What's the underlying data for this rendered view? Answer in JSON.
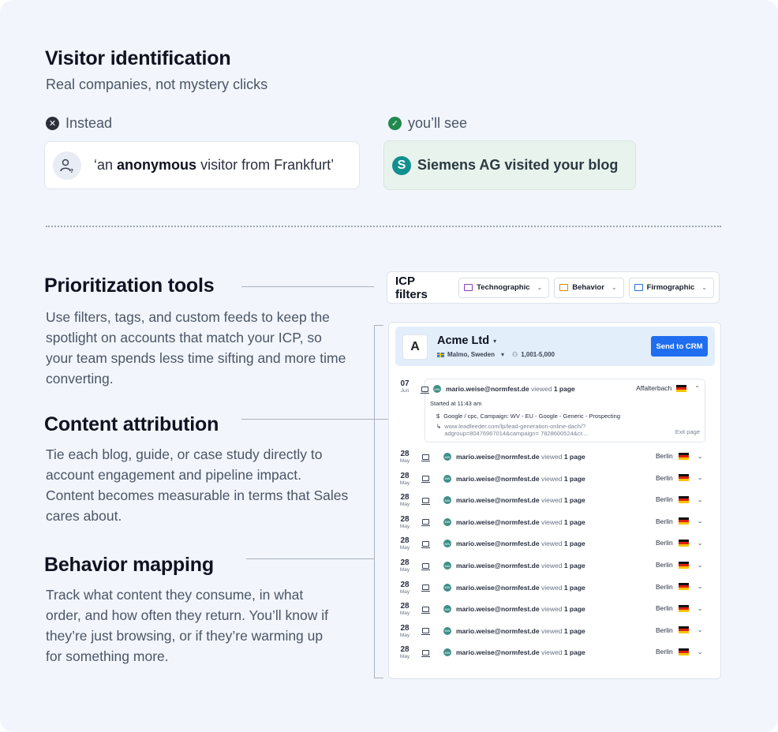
{
  "visitor": {
    "title": "Visitor identification",
    "subtitle": "Real companies, not mystery clicks",
    "instead_label": "Instead",
    "see_label": "you’ll see",
    "anon_prefix": "‘an",
    "anon_bold": "anonymous",
    "anon_suffix": "visitor from Frankfurt’",
    "known_logo_letter": "S",
    "known_text": "Siemens AG visited your blog"
  },
  "sections": [
    {
      "title": "Prioritization tools",
      "body": "Use filters, tags, and custom feeds to keep the spotlight on accounts that match your ICP, so your team spends less time sifting and more time converting."
    },
    {
      "title": "Content attribution",
      "body": "Tie each blog, guide, or case study directly to account engagement and pipeline impact. Content becomes measurable in terms that Sales cares about."
    },
    {
      "title": "Behavior mapping",
      "body": "Track what content they consume, in what order, and how often they return. You’ll know if they’re just browsing, or if they’re warming up for something more."
    }
  ],
  "icp": {
    "title": "ICP filters",
    "chips": [
      {
        "label": "Technographic",
        "icon": "technographic-icon",
        "color": "#8a3fb8"
      },
      {
        "label": "Behavior",
        "icon": "behavior-icon",
        "color": "#d88a00"
      },
      {
        "label": "Firmographic",
        "icon": "firmographic-icon",
        "color": "#2a6fd6"
      }
    ]
  },
  "account": {
    "name": "Acme Ltd",
    "logo_letter": "A",
    "location": "Malmo, Sweden",
    "employees": "1,001-5,000",
    "crm_button": "Send to CRM"
  },
  "expanded_visit": {
    "day": "07",
    "month": "Jun",
    "email": "mario.weise@normfest.de",
    "viewed": "viewed",
    "pages": "1 page",
    "city": "Affalterbach",
    "started": "Started at 11:43 am",
    "source": "Google / cpc, Campaign: WV - EU - Google - Generic - Prospecting",
    "url_line1": "www.leadfeeder.com/lp/lead-generation-online-dach/?",
    "url_line2": "adgroup=80476967014&campaign= 7828600524&cr....",
    "exit": "Exit page"
  },
  "visits": [
    {
      "day": "28",
      "month": "May",
      "email": "mario.weise@normfest.de",
      "viewed": "viewed",
      "pages": "1 page",
      "city": "Berlin"
    },
    {
      "day": "28",
      "month": "May",
      "email": "mario.weise@normfest.de",
      "viewed": "viewed",
      "pages": "1 page",
      "city": "Berlin"
    },
    {
      "day": "28",
      "month": "May",
      "email": "mario.weise@normfest.de",
      "viewed": "viewed",
      "pages": "1 page",
      "city": "Berlin"
    },
    {
      "day": "28",
      "month": "May",
      "email": "mario.weise@normfest.de",
      "viewed": "viewed",
      "pages": "1 page",
      "city": "Berlin"
    },
    {
      "day": "28",
      "month": "May",
      "email": "mario.weise@normfest.de",
      "viewed": "viewed",
      "pages": "1 page",
      "city": "Berlin"
    },
    {
      "day": "28",
      "month": "May",
      "email": "mario.weise@normfest.de",
      "viewed": "viewed",
      "pages": "1 page",
      "city": "Berlin"
    },
    {
      "day": "28",
      "month": "May",
      "email": "mario.weise@normfest.de",
      "viewed": "viewed",
      "pages": "1 page",
      "city": "Berlin"
    },
    {
      "day": "28",
      "month": "May",
      "email": "mario.weise@normfest.de",
      "viewed": "viewed",
      "pages": "1 page",
      "city": "Berlin"
    },
    {
      "day": "28",
      "month": "May",
      "email": "mario.weise@normfest.de",
      "viewed": "viewed",
      "pages": "1 page",
      "city": "Berlin"
    },
    {
      "day": "28",
      "month": "May",
      "email": "mario.weise@normfest.de",
      "viewed": "viewed",
      "pages": "1 page",
      "city": "Berlin"
    }
  ],
  "colors": {
    "background": "#f2f6fc",
    "accent": "#1f6ef0",
    "known_bg": "#e9f3ee",
    "siemens": "#11908f"
  }
}
